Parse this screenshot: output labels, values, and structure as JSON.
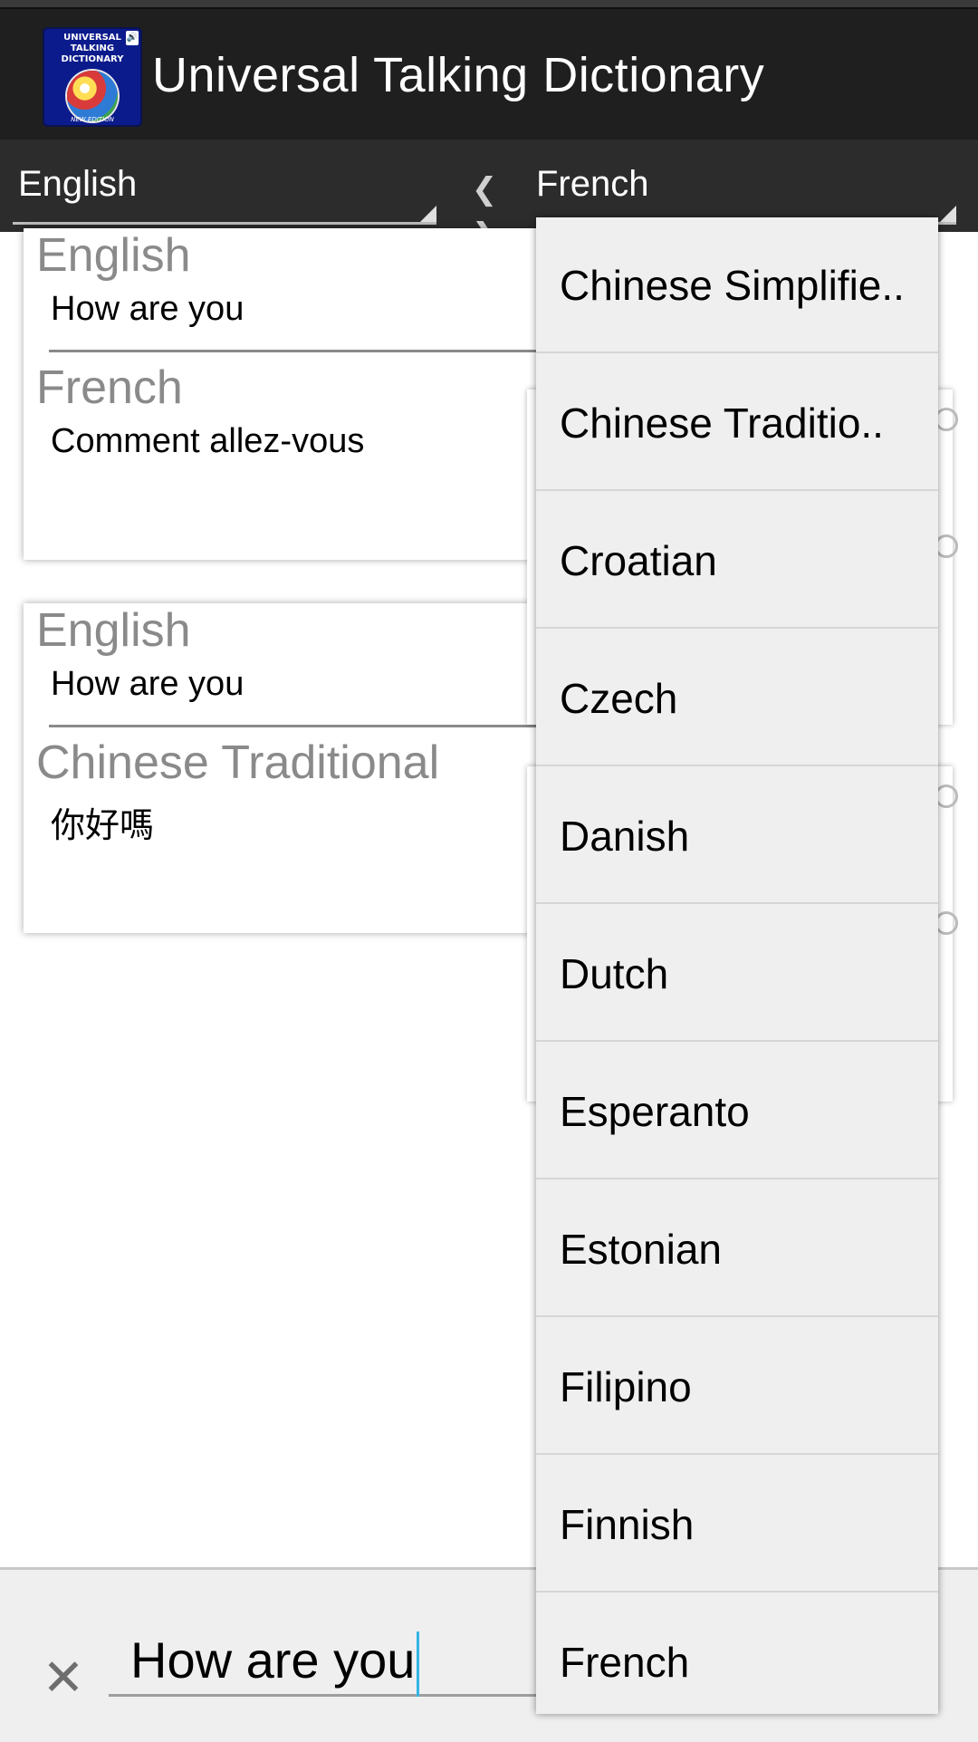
{
  "app": {
    "title": "Universal Talking Dictionary",
    "icon": {
      "text": "UNIVERSAL\nTALKING\nDICTIONARY",
      "edition": "NEW EDITION",
      "speaker_symbol": "🔊"
    }
  },
  "language_bar": {
    "source": "English",
    "target": "French",
    "swap_symbol": "❮ ❯"
  },
  "cards": [
    {
      "source_lang": "English",
      "source_text": "How are you",
      "target_lang": "French",
      "target_text": "Comment allez-vous"
    },
    {
      "source_lang": "English",
      "source_text": "How are you",
      "target_lang": "Chinese Traditional",
      "target_text": "你好嗎"
    }
  ],
  "dropdown": {
    "items": [
      "Chinese Simplifie..",
      "Chinese Traditio..",
      "Croatian",
      "Czech",
      "Danish",
      "Dutch",
      "Esperanto",
      "Estonian",
      "Filipino",
      "Finnish",
      "French"
    ]
  },
  "input": {
    "value": "How are you",
    "clear_symbol": "✕"
  },
  "colors": {
    "titlebar": "#1f1f1f",
    "langbar": "#2c2c2c",
    "caret": "#33b5e5",
    "dropdown_bg": "#efefef"
  }
}
